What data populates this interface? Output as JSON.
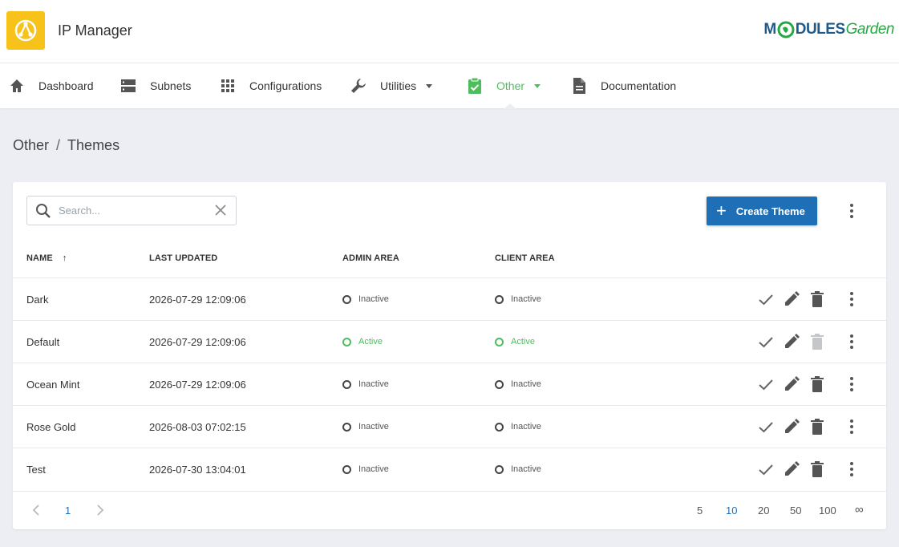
{
  "header": {
    "app_title": "IP Manager",
    "brand": {
      "part1": "M",
      "part2": "DULES",
      "part3": "Garden"
    }
  },
  "nav": {
    "items": [
      {
        "label": "Dashboard",
        "icon": "home-icon"
      },
      {
        "label": "Subnets",
        "icon": "server-icon"
      },
      {
        "label": "Configurations",
        "icon": "grid-icon"
      },
      {
        "label": "Utilities",
        "icon": "wrench-icon",
        "dropdown": true
      },
      {
        "label": "Other",
        "icon": "clipboard-icon",
        "dropdown": true,
        "active": true
      },
      {
        "label": "Documentation",
        "icon": "document-icon"
      }
    ]
  },
  "breadcrumb": {
    "parent": "Other",
    "separator": "/",
    "current": "Themes"
  },
  "toolbar": {
    "search_placeholder": "Search...",
    "create_label": "Create Theme"
  },
  "table": {
    "columns": [
      "NAME",
      "LAST UPDATED",
      "ADMIN AREA",
      "CLIENT AREA"
    ],
    "sort_indicator": "↑",
    "rows": [
      {
        "name": "Dark",
        "updated": "2026-07-29 12:09:06",
        "admin": "Inactive",
        "client": "Inactive"
      },
      {
        "name": "Default",
        "updated": "2026-07-29 12:09:06",
        "admin": "Active",
        "client": "Active"
      },
      {
        "name": "Ocean Mint",
        "updated": "2026-07-29 12:09:06",
        "admin": "Inactive",
        "client": "Inactive"
      },
      {
        "name": "Rose Gold",
        "updated": "2026-08-03 07:02:15",
        "admin": "Inactive",
        "client": "Inactive"
      },
      {
        "name": "Test",
        "updated": "2026-07-30 13:04:01",
        "admin": "Inactive",
        "client": "Inactive"
      }
    ]
  },
  "pagination": {
    "current_page": "1",
    "page_sizes": [
      "5",
      "10",
      "20",
      "50",
      "100",
      "∞"
    ],
    "selected_size": "10"
  },
  "colors": {
    "accent_green": "#4cbf5c",
    "primary_blue": "#1f6fb7",
    "logo_yellow": "#f7c219"
  }
}
